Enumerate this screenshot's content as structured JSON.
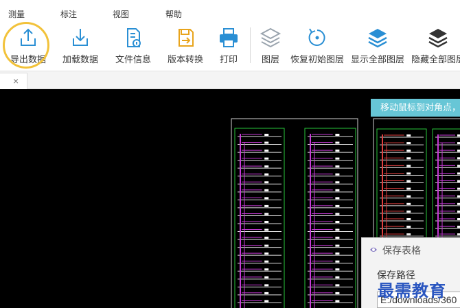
{
  "menu": {
    "items": [
      "测量",
      "标注",
      "视图",
      "帮助"
    ]
  },
  "toolbar": {
    "export_label": "导出数据",
    "load_label": "加载数据",
    "file_info_label": "文件信息",
    "version_convert_label": "版本转换",
    "print_label": "打印",
    "layers_label": "图层",
    "restore_layers_label": "恢复初始图层",
    "show_all_label": "显示全部图层",
    "hide_all_label": "隐藏全部图层"
  },
  "tabs": {
    "close_glyph": "×"
  },
  "canvas": {
    "tooltip": "移动鼠标到对角点，"
  },
  "dialog": {
    "title": "保存表格",
    "path_label": "保存路径",
    "path_value": "E:/downloads/360"
  },
  "watermark": "最需教育",
  "colors": {
    "accent_blue": "#2a8fd4",
    "highlight_yellow": "#f2c23a",
    "canvas_bg": "#000000",
    "tooltip_bg": "#67c6d6"
  },
  "icons": [
    "upload-icon",
    "download-icon",
    "file-info-icon",
    "convert-icon",
    "printer-icon",
    "layers-icon",
    "restore-icon",
    "layers-show-icon",
    "layers-hide-icon"
  ]
}
